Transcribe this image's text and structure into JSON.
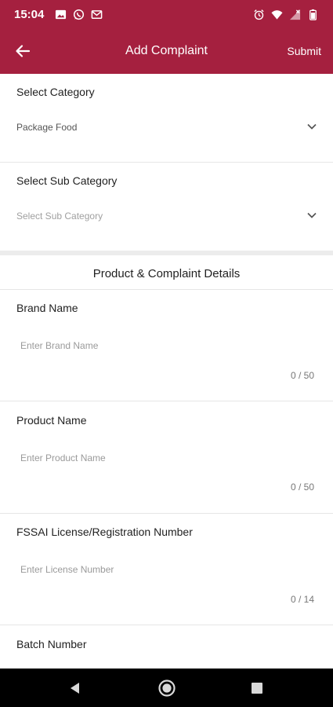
{
  "status_bar": {
    "time": "15:04",
    "left_icons": [
      "image-icon",
      "whatsapp-icon",
      "gmail-icon"
    ],
    "right_icons": [
      "alarm-icon",
      "wifi-icon",
      "signal-icon",
      "battery-icon"
    ]
  },
  "app_bar": {
    "title": "Add Complaint",
    "submit_label": "Submit",
    "background_color": "#a5203f"
  },
  "category": {
    "label": "Select Category",
    "value": "Package Food"
  },
  "sub_category": {
    "label": "Select Sub Category",
    "placeholder": "Select Sub Category"
  },
  "details": {
    "heading": "Product & Complaint Details"
  },
  "fields": [
    {
      "label": "Brand Name",
      "placeholder": "Enter Brand Name",
      "counter": "0 / 50"
    },
    {
      "label": "Product Name",
      "placeholder": "Enter Product Name",
      "counter": "0 / 50"
    },
    {
      "label": "FSSAI License/Registration Number",
      "placeholder": "Enter License Number",
      "counter": "0 / 14"
    },
    {
      "label": "Batch Number"
    }
  ],
  "nav_bar": {
    "buttons": [
      "back-nav-icon",
      "home-nav-icon",
      "recents-nav-icon"
    ]
  }
}
